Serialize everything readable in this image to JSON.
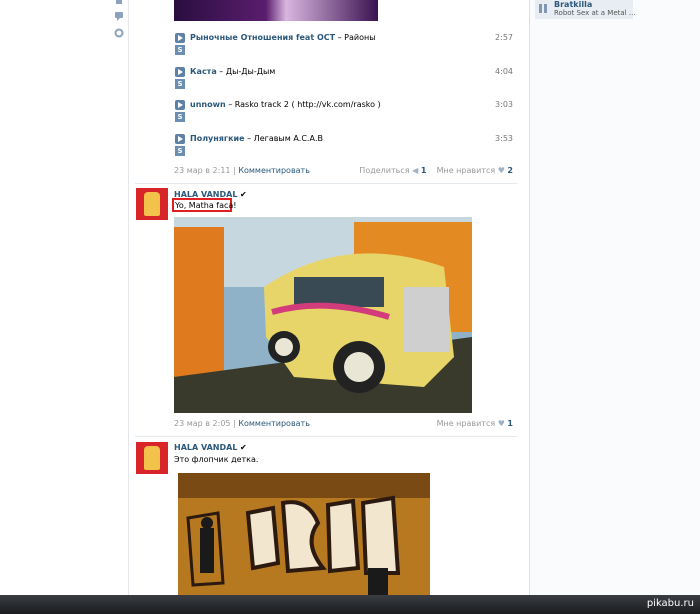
{
  "tracks": [
    {
      "artist": "Рыночные Отношения feat OCT",
      "title": "Районы",
      "duration": "2:57",
      "badge": "S"
    },
    {
      "artist": "Каста",
      "title": "Ды-Ды-Дым",
      "duration": "4:04",
      "badge": "S"
    },
    {
      "artist": "unnown",
      "title": "Rasko track 2 ( http://vk.com/rasko )",
      "duration": "3:03",
      "badge": "S"
    },
    {
      "artist": "Полунягкие",
      "title": "Легавым А.С.А.В",
      "duration": "3:53",
      "badge": "S"
    }
  ],
  "post1_footer": {
    "date": "23 мар в 2:11",
    "comment": "Комментировать",
    "share": "Поделиться",
    "share_count": "1",
    "like": "Мне нравится",
    "like_count": "2"
  },
  "post2": {
    "author": "HALA VANDAL",
    "verified": "✔",
    "text": "Yo, Matha faca!",
    "date": "23 мар в 2:05",
    "comment": "Комментировать",
    "like": "Мне нравится",
    "like_count": "1"
  },
  "post3": {
    "author": "HALA VANDAL",
    "verified": "✔",
    "text": "Это флопчик детка."
  },
  "sidebar_player": {
    "artist": "Bratkilla",
    "track": "Robot Sex at a Metal ..."
  },
  "watermark": "pikabu.ru",
  "colors": {
    "link": "#2b587a",
    "highlight_box": "#e02020",
    "bar": "#1a1c1f"
  }
}
